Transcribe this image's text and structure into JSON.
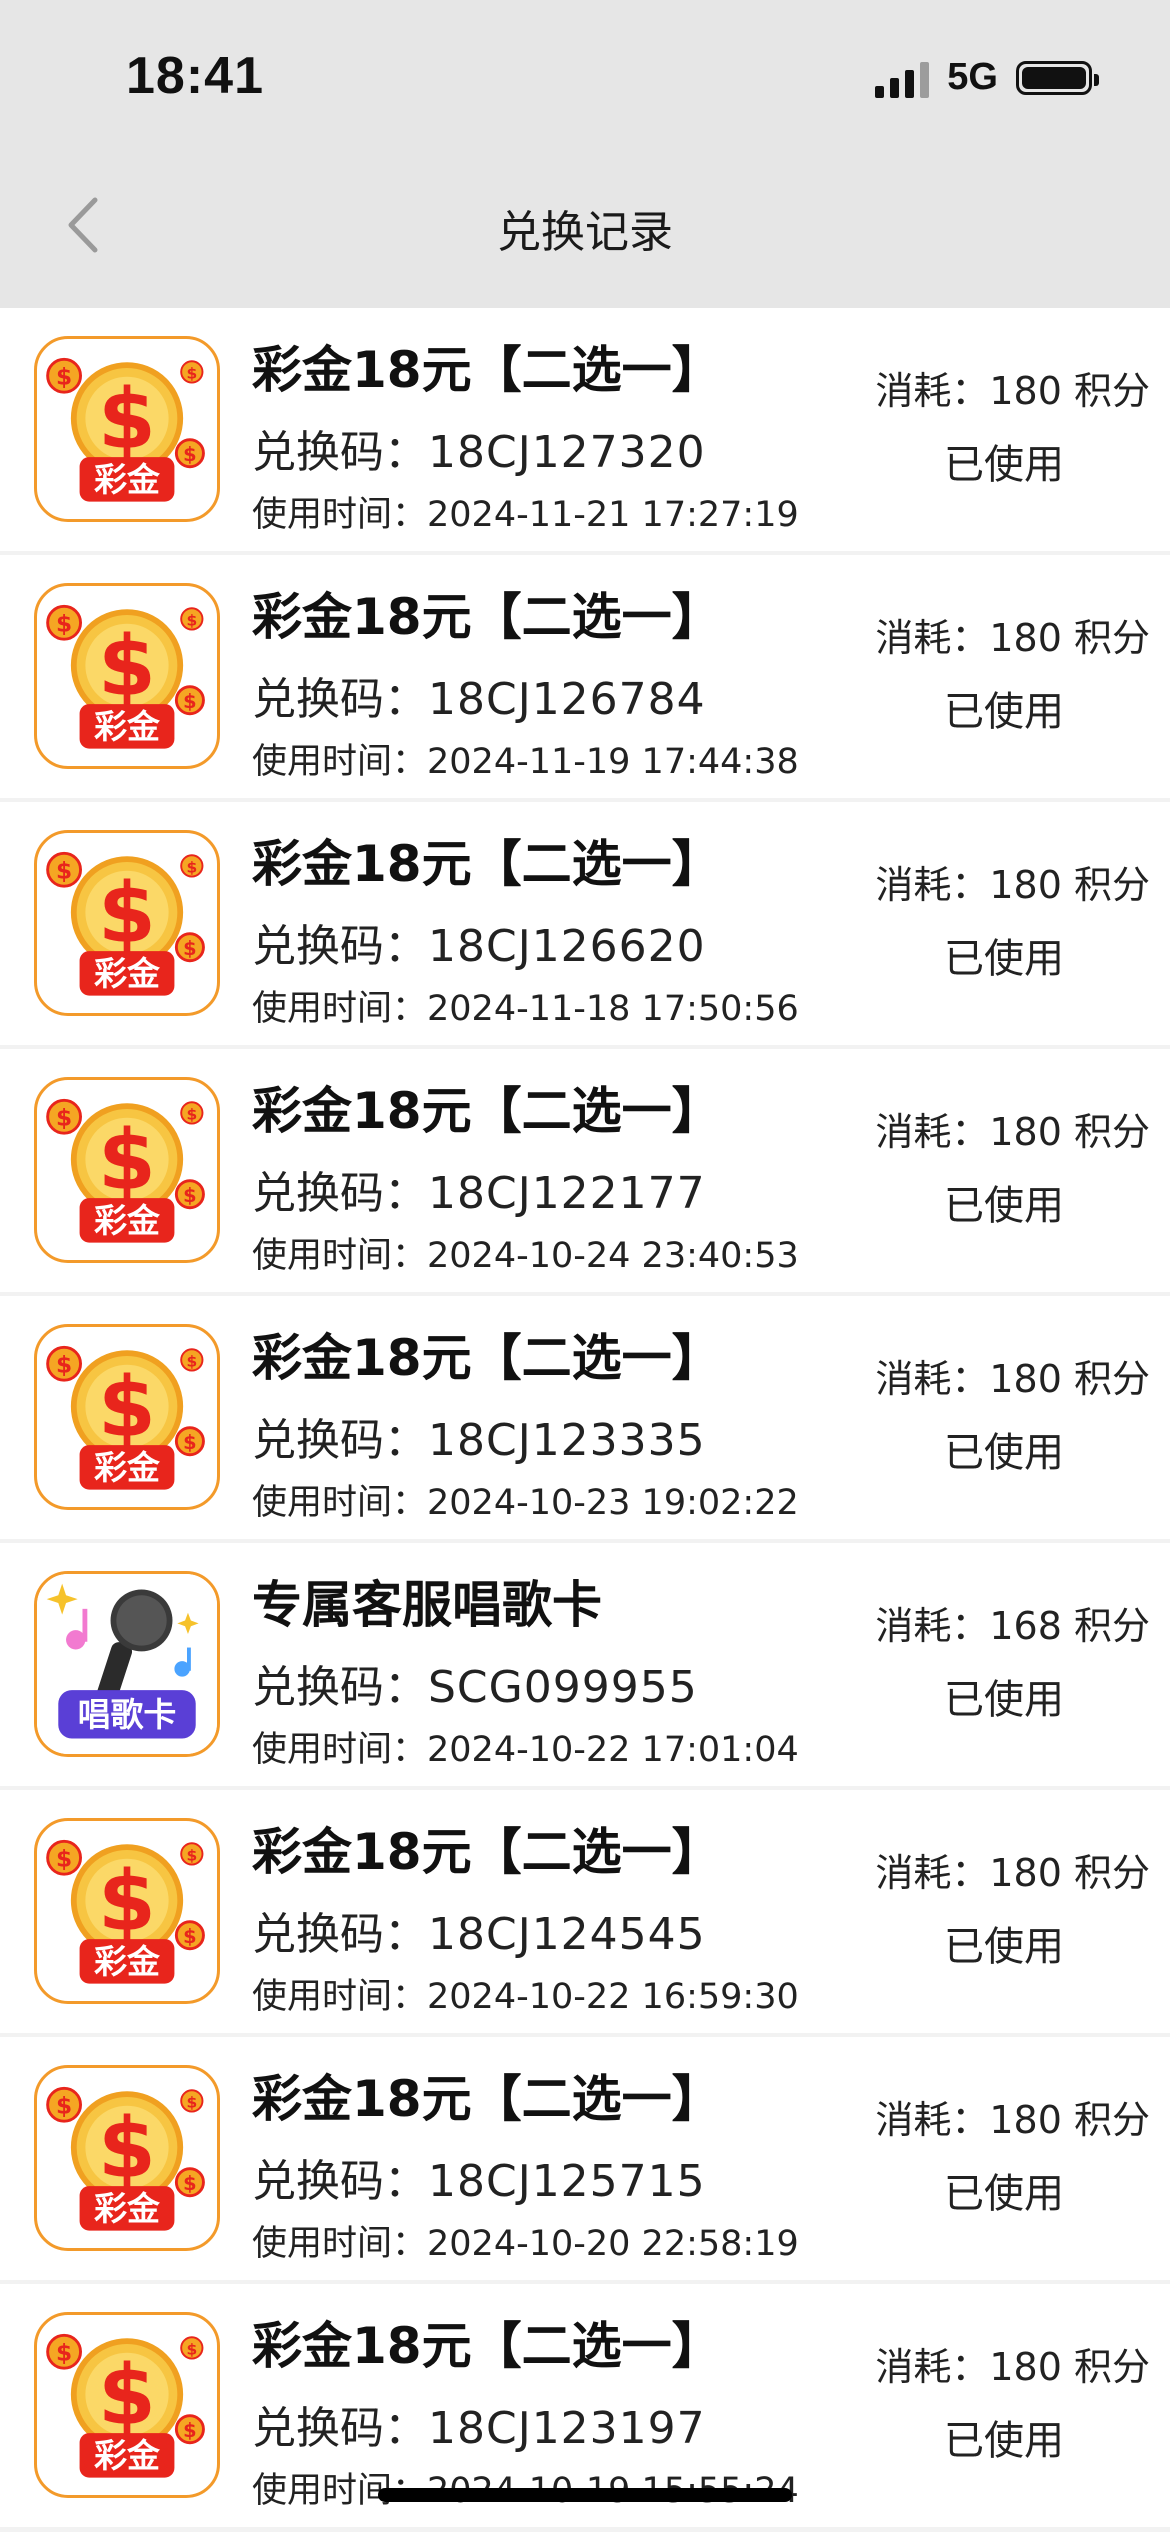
{
  "status_bar": {
    "time": "18:41",
    "network": "5G"
  },
  "nav": {
    "title": "兑换记录",
    "back_icon": "chevron-left-icon"
  },
  "labels": {
    "code_prefix": "兑换码：",
    "time_prefix": "使用时间：",
    "cost_prefix": "消耗：",
    "cost_suffix": "积分"
  },
  "colors": {
    "icon_border": "#f39a2a",
    "header_bg": "#e6e6e6",
    "coin": "#f5b730",
    "badge_red": "#e8251c"
  },
  "records": [
    {
      "icon": "caijin-coin-icon",
      "icon_text": "彩金",
      "title": "彩金18元【二选一】",
      "code": "18CJ127320",
      "time": "2024-11-21 17:27:19",
      "cost": "180",
      "status": "已使用"
    },
    {
      "icon": "caijin-coin-icon",
      "icon_text": "彩金",
      "title": "彩金18元【二选一】",
      "code": "18CJ126784",
      "time": "2024-11-19 17:44:38",
      "cost": "180",
      "status": "已使用"
    },
    {
      "icon": "caijin-coin-icon",
      "icon_text": "彩金",
      "title": "彩金18元【二选一】",
      "code": "18CJ126620",
      "time": "2024-11-18 17:50:56",
      "cost": "180",
      "status": "已使用"
    },
    {
      "icon": "caijin-coin-icon",
      "icon_text": "彩金",
      "title": "彩金18元【二选一】",
      "code": "18CJ122177",
      "time": "2024-10-24 23:40:53",
      "cost": "180",
      "status": "已使用"
    },
    {
      "icon": "caijin-coin-icon",
      "icon_text": "彩金",
      "title": "彩金18元【二选一】",
      "code": "18CJ123335",
      "time": "2024-10-23 19:02:22",
      "cost": "180",
      "status": "已使用"
    },
    {
      "icon": "microphone-card-icon",
      "icon_text": "唱歌卡",
      "title": "专属客服唱歌卡",
      "code": "SCG099955",
      "time": "2024-10-22 17:01:04",
      "cost": "168",
      "status": "已使用"
    },
    {
      "icon": "caijin-coin-icon",
      "icon_text": "彩金",
      "title": "彩金18元【二选一】",
      "code": "18CJ124545",
      "time": "2024-10-22 16:59:30",
      "cost": "180",
      "status": "已使用"
    },
    {
      "icon": "caijin-coin-icon",
      "icon_text": "彩金",
      "title": "彩金18元【二选一】",
      "code": "18CJ125715",
      "time": "2024-10-20 22:58:19",
      "cost": "180",
      "status": "已使用"
    },
    {
      "icon": "caijin-coin-icon",
      "icon_text": "彩金",
      "title": "彩金18元【二选一】",
      "code": "18CJ123197",
      "time": "2024-10-19 15:55:24",
      "cost": "180",
      "status": "已使用"
    }
  ]
}
